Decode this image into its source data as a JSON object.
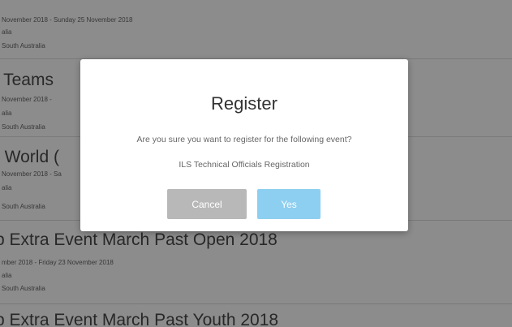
{
  "events": [
    {
      "title": "",
      "date": "November 2018 - Sunday 25 November 2018",
      "location_line": "alia",
      "venue": "South Australia"
    },
    {
      "title": "l Teams",
      "date": "November 2018 -",
      "location_line": "alia",
      "venue": "South Australia"
    },
    {
      "title": "t World (",
      "date": "November 2018 - Sa",
      "location_line": "alia",
      "venue": "South Australia"
    },
    {
      "title": "b Extra Event March Past Open 2018",
      "date": "mber 2018 - Friday 23 November 2018",
      "location_line": "alia",
      "venue": "South Australia"
    },
    {
      "title": "b Extra Event March Past Youth 2018",
      "date": "",
      "location_line": "",
      "venue": ""
    }
  ],
  "modal": {
    "title": "Register",
    "message": "Are you sure you want to register for the following event?",
    "event_name": "ILS Technical Officials Registration",
    "cancel_label": "Cancel",
    "yes_label": "Yes"
  },
  "colors": {
    "overlay": "rgba(0,0,0,0.45)",
    "cancel_button": "#b8b8b8",
    "yes_button": "#8dcff0"
  }
}
